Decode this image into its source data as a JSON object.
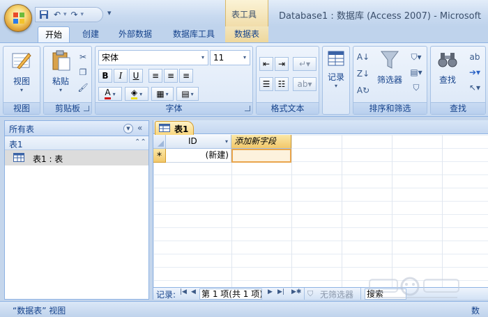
{
  "window": {
    "title": "Database1 : 数据库 (Access 2007) - Microsoft",
    "context_tab_header": "表工具"
  },
  "tabs": [
    {
      "label": "开始",
      "active": true
    },
    {
      "label": "创建"
    },
    {
      "label": "外部数据"
    },
    {
      "label": "数据库工具"
    },
    {
      "label": "数据表",
      "contextual": true
    }
  ],
  "ribbon": {
    "groups": {
      "views": {
        "label": "视图",
        "view_button": "视图"
      },
      "clipboard": {
        "label": "剪贴板",
        "paste_button": "粘贴"
      },
      "font": {
        "label": "字体",
        "font_name": "宋体",
        "font_size": "11",
        "bold": "B",
        "italic": "I",
        "underline": "U",
        "font_color_glyph": "A"
      },
      "rich_text": {
        "label": "格式文本"
      },
      "records": {
        "label": "记录",
        "records_button": "记录"
      },
      "sort_filter": {
        "label": "排序和筛选",
        "filter_button": "筛选器"
      },
      "find": {
        "label": "查找",
        "find_button": "查找"
      }
    }
  },
  "nav_pane": {
    "header": "所有表",
    "group": "表1",
    "items": [
      {
        "label": "表1 : 表"
      }
    ]
  },
  "document": {
    "tab": "表1",
    "columns": [
      {
        "label": "ID"
      },
      {
        "label": "添加新字段"
      }
    ],
    "new_row": {
      "selector": "*",
      "id_value": "(新建)"
    }
  },
  "record_navigator": {
    "label": "记录:",
    "position": "第 1 项(共 1 项)",
    "filter_status": "无筛选器",
    "search_placeholder": "搜索"
  },
  "statusbar": {
    "view": "“数据表” 视图",
    "right_text": "数"
  },
  "colors": {
    "ribbon_blue": "#dbe7f7",
    "accent_orange": "#f2c86a",
    "text_blue": "#15428b"
  }
}
